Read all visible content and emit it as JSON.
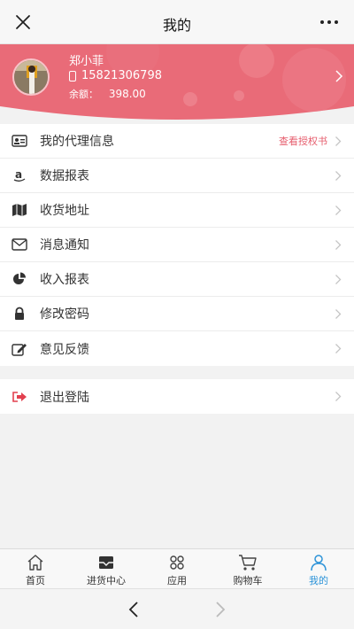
{
  "topbar": {
    "title": "我的",
    "close_icon": "close-icon",
    "more_icon": "more-icon"
  },
  "profile": {
    "name": "郑小菲",
    "phone": "15821306798",
    "balance_label": "余额：",
    "balance_value": "398.00",
    "bg_color": "#e96b78"
  },
  "menu": {
    "items": [
      {
        "label": "我的代理信息",
        "right": "查看授权书",
        "icon": "id-card-icon"
      },
      {
        "label": "数据报表",
        "icon": "amazon-icon"
      },
      {
        "label": "收货地址",
        "icon": "map-icon"
      },
      {
        "label": "消息通知",
        "icon": "envelope-icon"
      },
      {
        "label": "收入报表",
        "icon": "pie-chart-icon"
      },
      {
        "label": "修改密码",
        "icon": "lock-icon"
      },
      {
        "label": "意见反馈",
        "icon": "edit-icon"
      }
    ],
    "logout": {
      "label": "退出登陆",
      "icon": "sign-out-icon"
    }
  },
  "tabbar": {
    "items": [
      {
        "label": "首页",
        "icon": "home-icon"
      },
      {
        "label": "进货中心",
        "icon": "inbox-icon"
      },
      {
        "label": "应用",
        "icon": "apps-icon"
      },
      {
        "label": "购物车",
        "icon": "cart-icon"
      },
      {
        "label": "我的",
        "icon": "user-icon",
        "active": true
      }
    ],
    "active_color": "#2c93d8"
  },
  "browser": {
    "back_icon": "back-arrow-icon",
    "forward_icon": "forward-arrow-icon"
  }
}
